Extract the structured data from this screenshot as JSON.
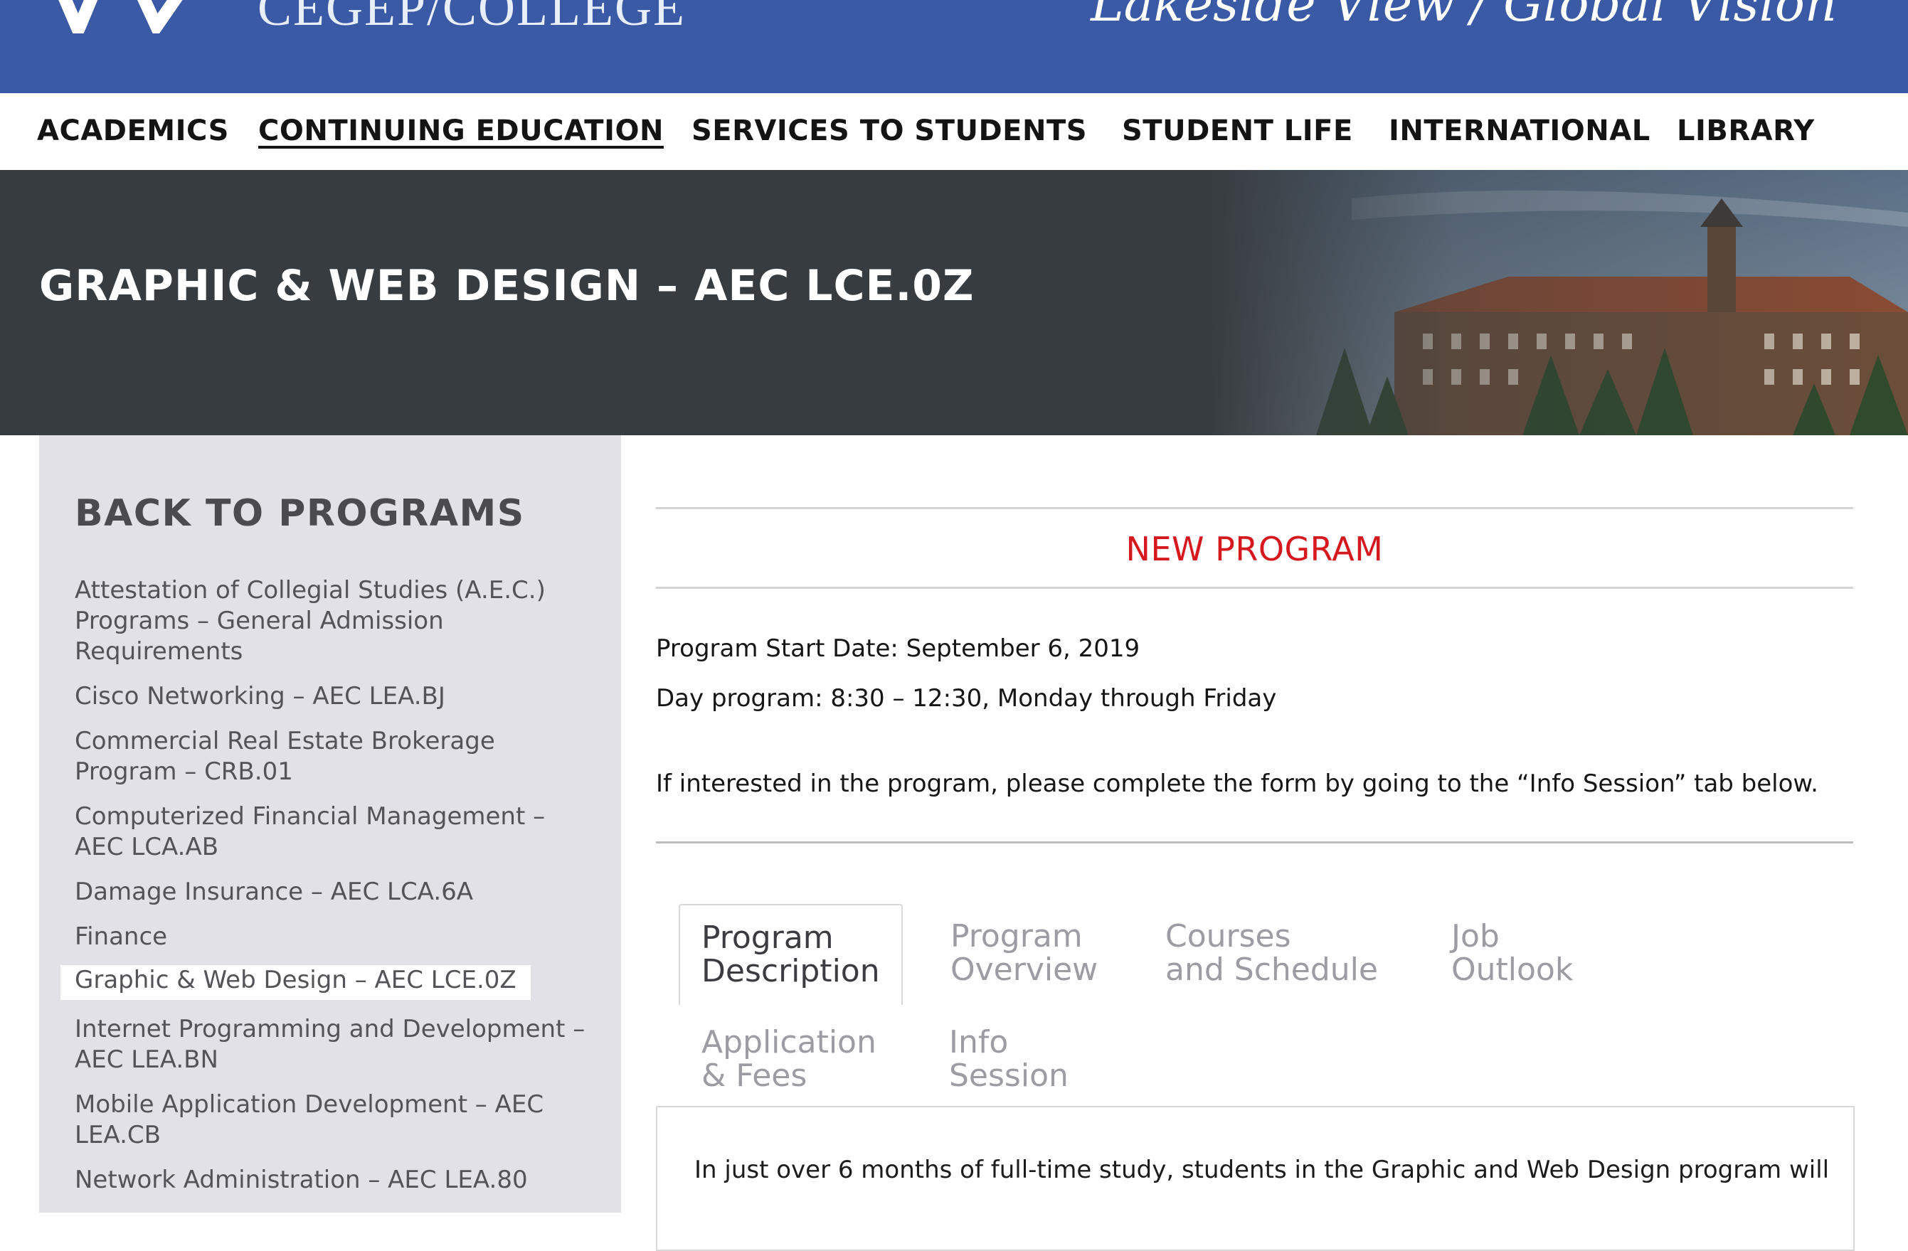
{
  "header": {
    "brand": "CEGEP/COLLEGE",
    "tagline": "Lakeside View / Global Vision"
  },
  "nav": {
    "items": [
      {
        "label": "ACADEMICS"
      },
      {
        "label": "CONTINUING EDUCATION"
      },
      {
        "label": "SERVICES TO STUDENTS"
      },
      {
        "label": "STUDENT LIFE"
      },
      {
        "label": "INTERNATIONAL"
      },
      {
        "label": "LIBRARY"
      }
    ],
    "active": "CONTINUING EDUCATION"
  },
  "hero": {
    "title": "GRAPHIC & WEB DESIGN – AEC LCE.0Z"
  },
  "sidebar": {
    "heading": "BACK TO PROGRAMS",
    "items": [
      {
        "label": "Attestation of Collegial Studies (A.E.C.) Programs – General Admission Requirements"
      },
      {
        "label": "Cisco Networking – AEC LEA.BJ"
      },
      {
        "label": "Commercial Real Estate Brokerage Program – CRB.01"
      },
      {
        "label": "Computerized Financial Management – AEC LCA.AB"
      },
      {
        "label": "Damage Insurance – AEC LCA.6A"
      },
      {
        "label": "Finance"
      },
      {
        "label": "Graphic & Web Design – AEC LCE.0Z"
      },
      {
        "label": "Internet Programming and Development – AEC LEA.BN"
      },
      {
        "label": "Mobile Application Development – AEC LEA.CB"
      },
      {
        "label": "Network Administration – AEC LEA.80"
      }
    ],
    "current": "Graphic & Web Design – AEC LCE.0Z"
  },
  "content": {
    "banner": "NEW PROGRAM",
    "start_date": "Program Start Date: September 6, 2019",
    "schedule": "Day program: 8:30 – 12:30, Monday through Friday",
    "interest_note": "If interested in the program, please complete the form by going to the “Info Session” tab below.",
    "tabs": [
      {
        "line1": "Program",
        "line2": "Description"
      },
      {
        "line1": "Program",
        "line2": "Overview"
      },
      {
        "line1": "Courses",
        "line2": "and Schedule"
      },
      {
        "line1": "Job",
        "line2": "Outlook"
      },
      {
        "line1": "Application",
        "line2": "& Fees"
      },
      {
        "line1": "Info",
        "line2": "Session"
      }
    ],
    "active_tab": "Program Description",
    "panel_text": "In just over 6 months of full-time study, students in the Graphic and Web Design program will"
  },
  "colors": {
    "banner_blue": "#3b5aa5",
    "hero_dark": "#373c40",
    "sidebar_bg": "#e3e1e8",
    "accent_red": "#d6181f"
  }
}
